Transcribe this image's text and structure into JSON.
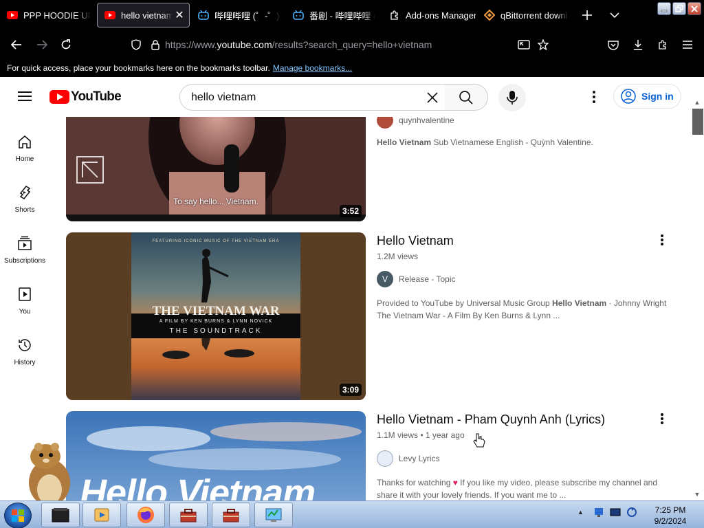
{
  "browser": {
    "tabs": [
      {
        "title": "PPP HOODIE UNB",
        "favicon": "youtube",
        "active": false
      },
      {
        "title": "hello vietnam -",
        "favicon": "youtube",
        "active": true
      },
      {
        "title": "哔哩哔哩 (゜-゜)つ",
        "favicon": "bilibili",
        "active": false
      },
      {
        "title": "番剧 - 哔哩哔哩 (",
        "favicon": "bilibili",
        "active": false
      },
      {
        "title": "Add-ons Manager",
        "favicon": "puzzle",
        "active": false
      },
      {
        "title": "qBittorrent downl",
        "favicon": "qbittorrent",
        "active": false
      }
    ],
    "url_prefix": "https://www.",
    "url_host": "youtube.com",
    "url_path": "/results?search_query=hello+vietnam",
    "bookmarks_message": "For quick access, place your bookmarks here on the bookmarks toolbar.",
    "bookmarks_link": "Manage bookmarks..."
  },
  "youtube": {
    "logo_text": "YouTube",
    "search_query": "hello vietnam",
    "signin_label": "Sign in",
    "guide": [
      {
        "label": "Home",
        "icon": "home-icon"
      },
      {
        "label": "Shorts",
        "icon": "shorts-icon"
      },
      {
        "label": "Subscriptions",
        "icon": "subscriptions-icon"
      },
      {
        "label": "You",
        "icon": "you-icon"
      },
      {
        "label": "History",
        "icon": "history-icon"
      }
    ],
    "results": [
      {
        "duration": "3:52",
        "caption": "To say hello... Vietnam.",
        "channel": "quynhvalentine",
        "description_bold": "Hello Vietnam",
        "description": " Sub Vietnamese English - Quỳnh Valentine."
      },
      {
        "title": "Hello Vietnam",
        "views": "1.2M views",
        "channel": "Release - Topic",
        "channel_initial": "V",
        "duration": "3:09",
        "thumb_top_text": "FEATURING ICONIC MUSIC OF THE VIETNAM ERA",
        "thumb_title": "THE VIETNAM WAR",
        "thumb_sub": "A FILM BY KEN BURNS & LYNN NOVICK",
        "thumb_sub2": "THE SOUNDTRACK",
        "description_pre": "Provided to YouTube by Universal Music Group ",
        "description_bold": "Hello Vietnam",
        "description_post": " · Johnny Wright The Vietnam War - A Film By Ken Burns & Lynn ..."
      },
      {
        "title": "Hello Vietnam - Pham Quynh Anh (Lyrics)",
        "views": "1.1M views",
        "age": "1 year ago",
        "channel": "Levy Lyrics",
        "thumb_text": "Hello Vietnam",
        "description_pre": "Thanks for watching ",
        "description_post": " If you like my video, please subscribe my channel and share it with your lovely friends. If you want me to ..."
      }
    ]
  },
  "taskbar": {
    "clock_time": "7:25 PM",
    "clock_date": "9/2/2024"
  }
}
